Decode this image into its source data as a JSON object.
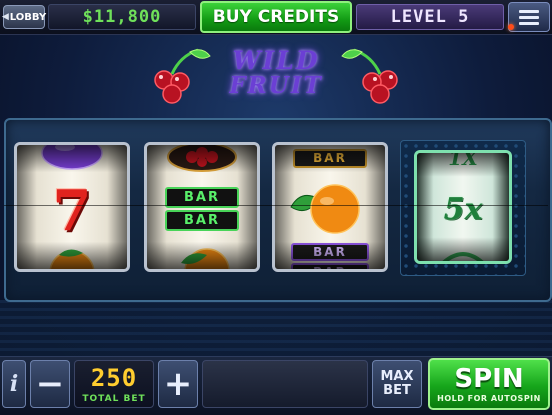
{
  "topbar": {
    "lobby_label": "LOBBY",
    "credits": "$11,800",
    "buy_credits_label": "BUY CREDITS",
    "level": "LEVEL 5"
  },
  "logo": {
    "line1": "WILD",
    "line2": "FRUIT"
  },
  "reels": {
    "reel1": [
      "plum",
      "seven",
      "orange"
    ],
    "reel2": [
      "cherries",
      "double-bar",
      "orange"
    ],
    "reel3": [
      "bar",
      "orange",
      "bar"
    ],
    "reel4": [
      "1x",
      "5x",
      "wild"
    ],
    "bar_text": "BAR",
    "seven_text": "7",
    "mult_top": "1X",
    "mult_main": "5x"
  },
  "bottombar": {
    "info_label": "i",
    "minus_label": "−",
    "bet_value": "250",
    "bet_label": "TOTAL BET",
    "plus_label": "+",
    "maxbet_line1": "MAX",
    "maxbet_line2": "BET",
    "spin_label": "SPIN",
    "spin_sub": "HOLD FOR AUTOSPIN"
  },
  "colors": {
    "accent_green": "#16a51b",
    "credits_green": "#6fe05a",
    "bet_yellow": "#ffcd2f",
    "logo_purple": "#6b3fd4"
  }
}
